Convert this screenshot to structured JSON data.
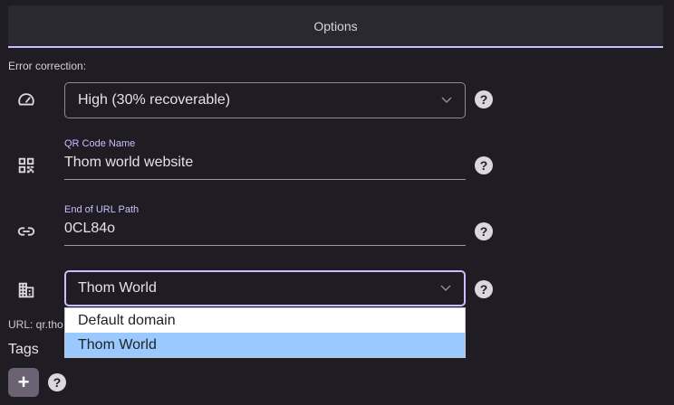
{
  "tabs": {
    "options_label": "Options"
  },
  "error_correction": {
    "label": "Error correction:",
    "selected": "High (30% recoverable)"
  },
  "qr_name": {
    "label": "QR Code Name",
    "value": "Thom world website"
  },
  "url_path": {
    "label": "End of URL Path",
    "value": "0CL84o"
  },
  "domain": {
    "selected": "Thom World",
    "options": [
      "Default domain",
      "Thom World"
    ]
  },
  "url_preview": "URL: qr.tho",
  "tags": {
    "label": "Tags",
    "add_label": "+"
  },
  "help_glyph": "?",
  "icons": {
    "error_correction": "speedometer-icon",
    "qr_name": "qr-code-icon",
    "url_path": "link-icon",
    "domain": "building-icon",
    "help": "help-circle-icon",
    "chevron": "chevron-down-icon"
  },
  "colors": {
    "background": "#1f1d23",
    "accent": "#c9bfff",
    "dropdown_selected": "#99c9ff"
  }
}
